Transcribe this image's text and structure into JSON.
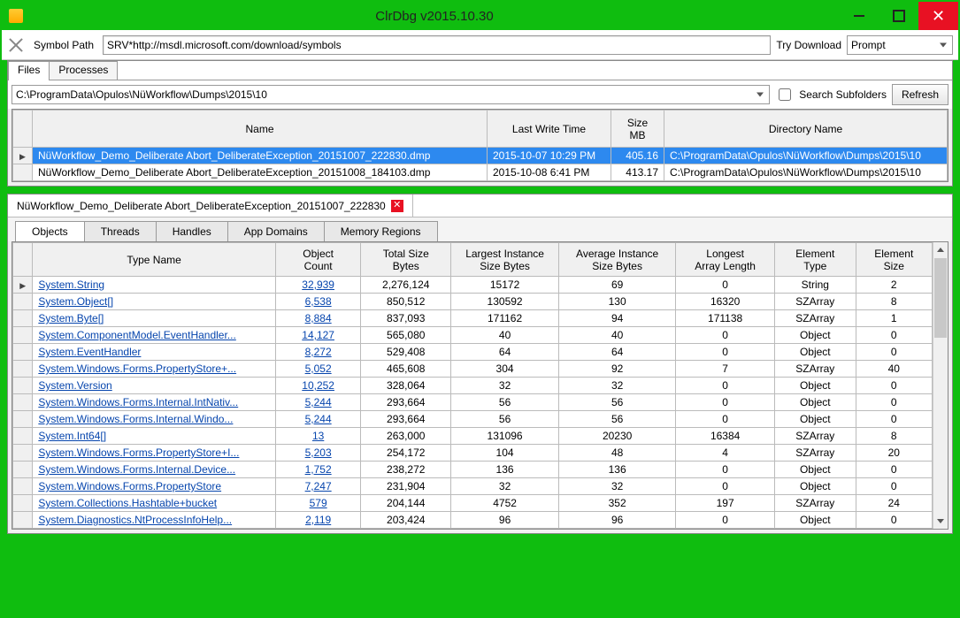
{
  "title": "ClrDbg v2015.10.30",
  "toolbar": {
    "symbol_label": "Symbol Path",
    "symbol_value": "SRV*http://msdl.microsoft.com/download/symbols",
    "try_download": "Try Download",
    "prompt": "Prompt"
  },
  "fileTabs": {
    "files": "Files",
    "processes": "Processes"
  },
  "pathRow": {
    "path": "C:\\ProgramData\\Opulos\\NüWorkflow\\Dumps\\2015\\10",
    "search_sub": "Search Subfolders",
    "refresh": "Refresh"
  },
  "filesGrid": {
    "headers": {
      "name": "Name",
      "lwt": "Last Write Time",
      "size": "Size\nMB",
      "dir": "Directory Name"
    },
    "rows": [
      {
        "sel": true,
        "name": "NüWorkflow_Demo_Deliberate Abort_DeliberateException_20151007_222830.dmp",
        "lwt": "2015-10-07 10:29 PM",
        "size": "405.16",
        "dir": "C:\\ProgramData\\Opulos\\NüWorkflow\\Dumps\\2015\\10"
      },
      {
        "sel": false,
        "name": "NüWorkflow_Demo_Deliberate Abort_DeliberateException_20151008_184103.dmp",
        "lwt": "2015-10-08 6:41 PM",
        "size": "413.17",
        "dir": "C:\\ProgramData\\Opulos\\NüWorkflow\\Dumps\\2015\\10"
      }
    ]
  },
  "docTab": "NüWorkflow_Demo_Deliberate Abort_DeliberateException_20151007_222830",
  "subTabs": {
    "objects": "Objects",
    "threads": "Threads",
    "handles": "Handles",
    "appdomains": "App Domains",
    "memregions": "Memory Regions"
  },
  "objectsGrid": {
    "headers": {
      "type": "Type Name",
      "count": "Object\nCount",
      "total": "Total Size\nBytes",
      "largest": "Largest Instance\nSize Bytes",
      "avg": "Average Instance\nSize Bytes",
      "longest": "Longest\nArray Length",
      "etype": "Element\nType",
      "esize": "Element\nSize"
    },
    "rows": [
      {
        "type": "System.String",
        "count": "32,939",
        "total": "2,276,124",
        "largest": "15172",
        "avg": "69",
        "longest": "0",
        "etype": "String",
        "esize": "2"
      },
      {
        "type": "System.Object[]",
        "count": "6,538",
        "total": "850,512",
        "largest": "130592",
        "avg": "130",
        "longest": "16320",
        "etype": "SZArray",
        "esize": "8"
      },
      {
        "type": "System.Byte[]",
        "count": "8,884",
        "total": "837,093",
        "largest": "171162",
        "avg": "94",
        "longest": "171138",
        "etype": "SZArray",
        "esize": "1"
      },
      {
        "type": "System.ComponentModel.EventHandler...",
        "count": "14,127",
        "total": "565,080",
        "largest": "40",
        "avg": "40",
        "longest": "0",
        "etype": "Object",
        "esize": "0"
      },
      {
        "type": "System.EventHandler",
        "count": "8,272",
        "total": "529,408",
        "largest": "64",
        "avg": "64",
        "longest": "0",
        "etype": "Object",
        "esize": "0"
      },
      {
        "type": "System.Windows.Forms.PropertyStore+...",
        "count": "5,052",
        "total": "465,608",
        "largest": "304",
        "avg": "92",
        "longest": "7",
        "etype": "SZArray",
        "esize": "40"
      },
      {
        "type": "System.Version",
        "count": "10,252",
        "total": "328,064",
        "largest": "32",
        "avg": "32",
        "longest": "0",
        "etype": "Object",
        "esize": "0"
      },
      {
        "type": "System.Windows.Forms.Internal.IntNativ...",
        "count": "5,244",
        "total": "293,664",
        "largest": "56",
        "avg": "56",
        "longest": "0",
        "etype": "Object",
        "esize": "0"
      },
      {
        "type": "System.Windows.Forms.Internal.Windo...",
        "count": "5,244",
        "total": "293,664",
        "largest": "56",
        "avg": "56",
        "longest": "0",
        "etype": "Object",
        "esize": "0"
      },
      {
        "type": "System.Int64[]",
        "count": "13",
        "total": "263,000",
        "largest": "131096",
        "avg": "20230",
        "longest": "16384",
        "etype": "SZArray",
        "esize": "8"
      },
      {
        "type": "System.Windows.Forms.PropertyStore+I...",
        "count": "5,203",
        "total": "254,172",
        "largest": "104",
        "avg": "48",
        "longest": "4",
        "etype": "SZArray",
        "esize": "20"
      },
      {
        "type": "System.Windows.Forms.Internal.Device...",
        "count": "1,752",
        "total": "238,272",
        "largest": "136",
        "avg": "136",
        "longest": "0",
        "etype": "Object",
        "esize": "0"
      },
      {
        "type": "System.Windows.Forms.PropertyStore",
        "count": "7,247",
        "total": "231,904",
        "largest": "32",
        "avg": "32",
        "longest": "0",
        "etype": "Object",
        "esize": "0"
      },
      {
        "type": "System.Collections.Hashtable+bucket",
        "count": "579",
        "total": "204,144",
        "largest": "4752",
        "avg": "352",
        "longest": "197",
        "etype": "SZArray",
        "esize": "24"
      },
      {
        "type": "System.Diagnostics.NtProcessInfoHelp...",
        "count": "2,119",
        "total": "203,424",
        "largest": "96",
        "avg": "96",
        "longest": "0",
        "etype": "Object",
        "esize": "0"
      }
    ]
  }
}
